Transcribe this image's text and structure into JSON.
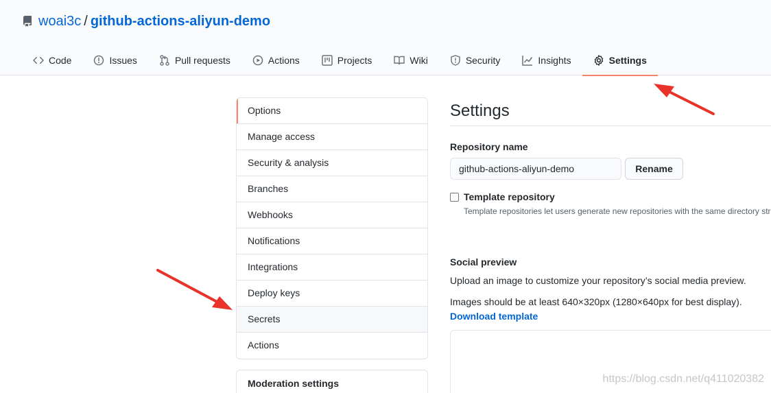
{
  "repo": {
    "owner": "woai3c",
    "separator": "/",
    "name": "github-actions-aliyun-demo"
  },
  "tabs": [
    {
      "label": "Code",
      "icon": "code-icon"
    },
    {
      "label": "Issues",
      "icon": "issue-icon"
    },
    {
      "label": "Pull requests",
      "icon": "pull-request-icon"
    },
    {
      "label": "Actions",
      "icon": "play-icon"
    },
    {
      "label": "Projects",
      "icon": "project-icon"
    },
    {
      "label": "Wiki",
      "icon": "book-icon"
    },
    {
      "label": "Security",
      "icon": "shield-icon"
    },
    {
      "label": "Insights",
      "icon": "graph-icon"
    },
    {
      "label": "Settings",
      "icon": "gear-icon",
      "selected": true
    }
  ],
  "sidebar": {
    "items": [
      {
        "label": "Options",
        "selected": true
      },
      {
        "label": "Manage access"
      },
      {
        "label": "Security & analysis"
      },
      {
        "label": "Branches"
      },
      {
        "label": "Webhooks"
      },
      {
        "label": "Notifications"
      },
      {
        "label": "Integrations"
      },
      {
        "label": "Deploy keys"
      },
      {
        "label": "Secrets",
        "hover": true
      },
      {
        "label": "Actions"
      }
    ],
    "moderation_title": "Moderation settings"
  },
  "main": {
    "title": "Settings",
    "repo_name_label": "Repository name",
    "repo_name_value": "github-actions-aliyun-demo",
    "rename_button": "Rename",
    "template_label": "Template repository",
    "template_note": "Template repositories let users generate new repositories with the same directory stru",
    "social_title": "Social preview",
    "social_desc": "Upload an image to customize your repository’s social media preview.",
    "social_size": "Images should be at least 640×320px (1280×640px for best display).",
    "download_link": "Download template"
  },
  "watermark": "https://blog.csdn.net/q411020382",
  "colors": {
    "accent": "#f9826c",
    "link": "#0366d6",
    "annotation_arrow": "#e8322a"
  }
}
